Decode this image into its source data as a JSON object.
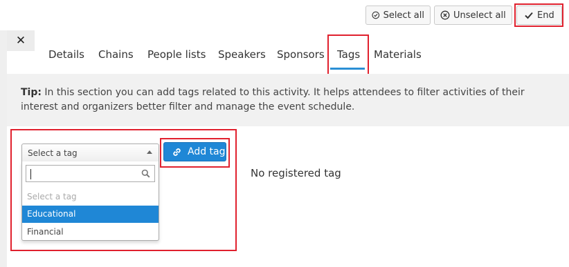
{
  "toolbar": {
    "select_all_label": "Select all",
    "unselect_all_label": "Unselect all",
    "end_label": "End"
  },
  "close_glyph": "✕",
  "tabs": [
    {
      "label": "Details"
    },
    {
      "label": "Chains"
    },
    {
      "label": "People lists"
    },
    {
      "label": "Speakers"
    },
    {
      "label": "Sponsors"
    },
    {
      "label": "Tags",
      "active": true
    },
    {
      "label": "Materials"
    }
  ],
  "tip": {
    "prefix": "Tip:",
    "text": "In this section you can add tags related to this activity. It helps attendees to filter activities of their interest and organizers better filter and manage the event schedule."
  },
  "tag_select": {
    "selected_label": "Select a tag",
    "search_value": "",
    "options": [
      "Select a tag",
      "Educational",
      "Financial"
    ],
    "highlighted_option": "Educational"
  },
  "add_tag_label": "Add tag",
  "empty_message": "No registered tag",
  "colors": {
    "accent": "#1f87d6",
    "highlight_box": "#e0202d",
    "tab_underline": "#2b8fd5"
  },
  "icons": {
    "select_all": "check-circle-icon",
    "unselect_all": "x-circle-icon",
    "end": "check-icon",
    "close": "close-icon",
    "search": "search-icon",
    "add_tag": "link-icon",
    "dropdown_toggle": "chevron-up-icon"
  }
}
